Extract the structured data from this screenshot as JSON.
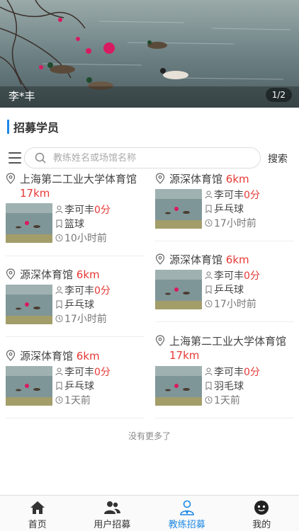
{
  "banner": {
    "title": "李*丰",
    "indicator": "1/2"
  },
  "section": {
    "title": "招募学员"
  },
  "search": {
    "placeholder": "教练姓名或场馆名称",
    "button_label": "搜索"
  },
  "cards": [
    {
      "venue": "上海第二工业大学体育馆",
      "distance": "17km",
      "coach": "李可丰",
      "price": "0分",
      "sport": "篮球",
      "time": "10小时前"
    },
    {
      "venue": "源深体育馆",
      "distance": "6km",
      "coach": "李可丰",
      "price": "0分",
      "sport": "乒乓球",
      "time": "17小时前"
    },
    {
      "venue": "源深体育馆",
      "distance": "6km",
      "coach": "李可丰",
      "price": "0分",
      "sport": "乒乓球",
      "time": "17小时前"
    },
    {
      "venue": "源深体育馆",
      "distance": "6km",
      "coach": "李可丰",
      "price": "0分",
      "sport": "乒乓球",
      "time": "17小时前"
    },
    {
      "venue": "源深体育馆",
      "distance": "6km",
      "coach": "李可丰",
      "price": "0分",
      "sport": "乒乓球",
      "time": "1天前"
    },
    {
      "venue": "上海第二工业大学体育馆",
      "distance": "17km",
      "coach": "李可丰",
      "price": "0分",
      "sport": "羽毛球",
      "time": "1天前"
    }
  ],
  "footer": {
    "no_more": "没有更多了"
  },
  "tabbar": {
    "items": [
      {
        "label": "首页",
        "icon": "home-icon"
      },
      {
        "label": "用户招募",
        "icon": "users-icon"
      },
      {
        "label": "教练招募",
        "icon": "coach-icon"
      },
      {
        "label": "我的",
        "icon": "profile-icon"
      }
    ],
    "active_index": 2
  },
  "colors": {
    "accent": "#1e88e5",
    "price": "#e53935"
  }
}
